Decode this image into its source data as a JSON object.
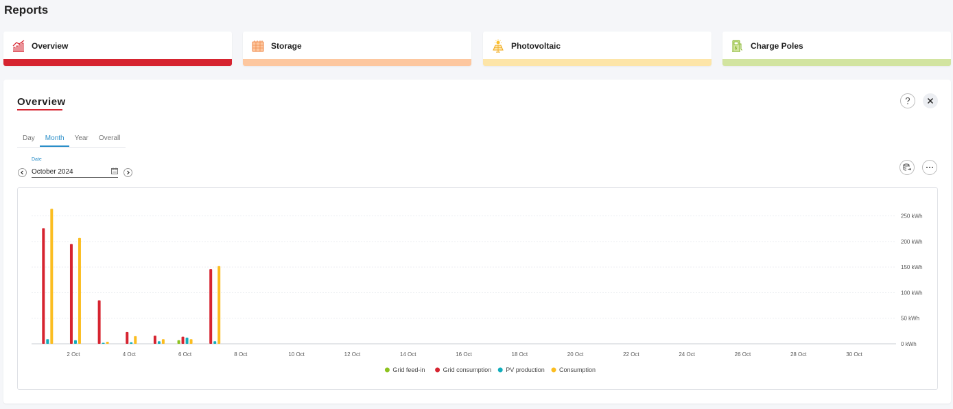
{
  "page": {
    "title": "Reports"
  },
  "cards": [
    {
      "label": "Overview",
      "icon": "chart-line-icon",
      "color": "#d62430"
    },
    {
      "label": "Storage",
      "icon": "battery-icon",
      "color": "#fdc79f"
    },
    {
      "label": "Photovoltaic",
      "icon": "solar-panel-icon",
      "color": "#fde5a8"
    },
    {
      "label": "Charge Poles",
      "icon": "charging-station-icon",
      "color": "#d2e4a0"
    }
  ],
  "panel": {
    "title": "Overview",
    "tabs": [
      {
        "label": "Day",
        "active": false
      },
      {
        "label": "Month",
        "active": true
      },
      {
        "label": "Year",
        "active": false
      },
      {
        "label": "Overall",
        "active": false
      }
    ],
    "date_label": "Date",
    "date_value": "October 2024"
  },
  "chart_data": {
    "type": "bar",
    "title": "",
    "xlabel": "",
    "ylabel": "",
    "x": [
      1,
      2,
      3,
      4,
      5,
      6,
      7,
      8,
      9,
      10,
      11,
      12,
      13,
      14,
      15,
      16,
      17,
      18,
      19,
      20,
      21,
      22,
      23,
      24,
      25,
      26,
      27,
      28,
      29,
      30,
      31
    ],
    "x_tick_labels": [
      "2 Oct",
      "4 Oct",
      "6 Oct",
      "8 Oct",
      "10 Oct",
      "12 Oct",
      "14 Oct",
      "16 Oct",
      "18 Oct",
      "20 Oct",
      "22 Oct",
      "24 Oct",
      "26 Oct",
      "28 Oct",
      "30 Oct"
    ],
    "x_tick_values": [
      2,
      4,
      6,
      8,
      10,
      12,
      14,
      16,
      18,
      20,
      22,
      24,
      26,
      28,
      30
    ],
    "y_ticks": [
      0,
      50,
      100,
      150,
      200,
      250
    ],
    "y_tick_labels": [
      "0 kWh",
      "50 kWh",
      "100 kWh",
      "150 kWh",
      "200 kWh",
      "250 kWh"
    ],
    "ylim": [
      0,
      275
    ],
    "y_axis_position": "right",
    "grid": true,
    "legend_position": "bottom",
    "series": [
      {
        "name": "Grid feed-in",
        "color": "#8dc21f",
        "values": [
          0,
          0,
          0,
          0,
          0,
          7,
          0,
          0,
          0,
          0,
          0,
          0,
          0,
          0,
          0,
          0,
          0,
          0,
          0,
          0,
          0,
          0,
          0,
          0,
          0,
          0,
          0,
          0,
          0,
          0,
          0
        ]
      },
      {
        "name": "Grid consumption",
        "color": "#d62430",
        "values": [
          226,
          195,
          85,
          23,
          16,
          14,
          146,
          0,
          0,
          0,
          0,
          0,
          0,
          0,
          0,
          0,
          0,
          0,
          0,
          0,
          0,
          0,
          0,
          0,
          0,
          0,
          0,
          0,
          0,
          0,
          0
        ]
      },
      {
        "name": "PV production",
        "color": "#12aebc",
        "values": [
          9,
          7,
          2,
          3,
          5,
          12,
          5,
          0,
          0,
          0,
          0,
          0,
          0,
          0,
          0,
          0,
          0,
          0,
          0,
          0,
          0,
          0,
          0,
          0,
          0,
          0,
          0,
          0,
          0,
          0,
          0
        ]
      },
      {
        "name": "Consumption",
        "color": "#fbbd20",
        "values": [
          264,
          207,
          4,
          15,
          9,
          9,
          152,
          0,
          0,
          0,
          0,
          0,
          0,
          0,
          0,
          0,
          0,
          0,
          0,
          0,
          0,
          0,
          0,
          0,
          0,
          0,
          0,
          0,
          0,
          0,
          0
        ]
      }
    ]
  }
}
